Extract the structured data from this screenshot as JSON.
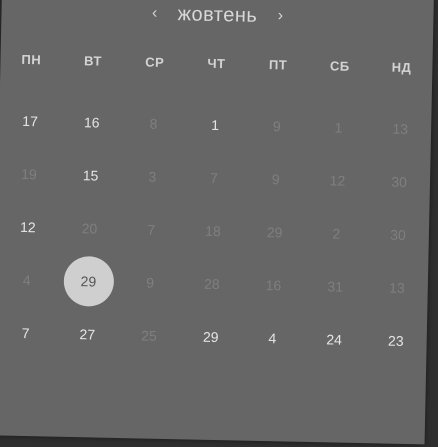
{
  "calendar": {
    "month": "жовтень",
    "prev_icon": "chevron-left-icon",
    "next_icon": "chevron-right-icon",
    "prev_glyph": "‹",
    "next_glyph": "›",
    "weekdays": [
      "ПН",
      "ВТ",
      "СР",
      "ЧТ",
      "ПТ",
      "СБ",
      "НД"
    ],
    "weeks": [
      [
        {
          "d": "17",
          "on": true
        },
        {
          "d": "16",
          "on": true
        },
        {
          "d": "8",
          "on": false
        },
        {
          "d": "1",
          "on": true
        },
        {
          "d": "9",
          "on": false
        },
        {
          "d": "1",
          "on": false
        },
        {
          "d": "13",
          "on": false
        }
      ],
      [
        {
          "d": "19",
          "on": false
        },
        {
          "d": "15",
          "on": true
        },
        {
          "d": "3",
          "on": false
        },
        {
          "d": "7",
          "on": false
        },
        {
          "d": "9",
          "on": false
        },
        {
          "d": "12",
          "on": false
        },
        {
          "d": "30",
          "on": false
        }
      ],
      [
        {
          "d": "12",
          "on": true
        },
        {
          "d": "20",
          "on": false
        },
        {
          "d": "7",
          "on": false
        },
        {
          "d": "18",
          "on": false
        },
        {
          "d": "29",
          "on": false
        },
        {
          "d": "2",
          "on": false
        },
        {
          "d": "30",
          "on": false
        }
      ],
      [
        {
          "d": "4",
          "on": false
        },
        {
          "d": "29",
          "on": true,
          "selected": true
        },
        {
          "d": "9",
          "on": false
        },
        {
          "d": "28",
          "on": false
        },
        {
          "d": "16",
          "on": false
        },
        {
          "d": "31",
          "on": false
        },
        {
          "d": "13",
          "on": false
        }
      ],
      [
        {
          "d": "7",
          "on": true
        },
        {
          "d": "27",
          "on": true
        },
        {
          "d": "25",
          "on": false
        },
        {
          "d": "29",
          "on": true
        },
        {
          "d": "4",
          "on": true
        },
        {
          "d": "24",
          "on": true
        },
        {
          "d": "23",
          "on": true
        }
      ]
    ],
    "colors": {
      "card_bg": "#666666",
      "day_active": "#e6e6e6",
      "day_muted": "#7f7f7f",
      "selected_bg": "#cfcfcf"
    }
  }
}
